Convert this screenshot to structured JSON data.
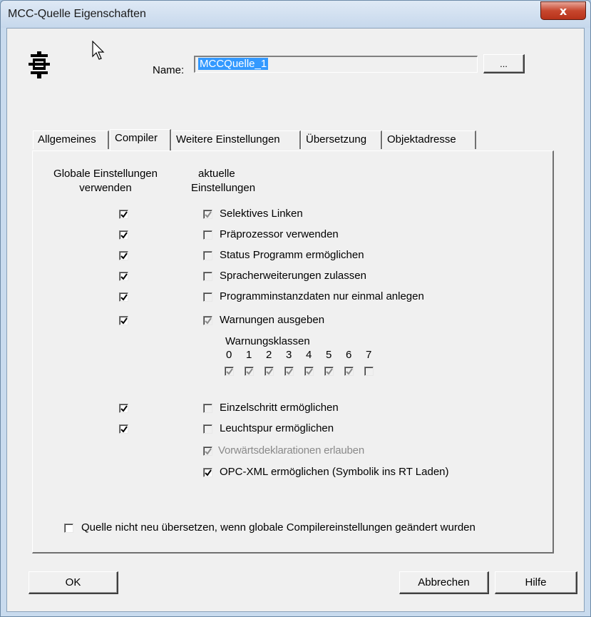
{
  "window": {
    "title": "MCC-Quelle Eigenschaften",
    "close_glyph": "x"
  },
  "header": {
    "icon": "mcc-source-icon",
    "name_label": "Name:",
    "name_value": "MCCQuelle_1",
    "browse_label": "..."
  },
  "tabs": [
    {
      "label": "Allgemeines",
      "active": false
    },
    {
      "label": "Compiler",
      "active": true
    },
    {
      "label": "Weitere Einstellungen",
      "active": false
    },
    {
      "label": "Übersetzung",
      "active": false
    },
    {
      "label": "Objektadresse",
      "active": false
    }
  ],
  "compiler": {
    "col_global_line1": "Globale Einstellungen",
    "col_global_line2": "verwenden",
    "col_current_line1": "aktuelle",
    "col_current_line2": "Einstellungen",
    "options": [
      {
        "label": "Selektives Linken",
        "global": true,
        "current": true,
        "current_enabled": false
      },
      {
        "label": "Präprozessor verwenden",
        "global": true,
        "current": false,
        "current_enabled": false
      },
      {
        "label": "Status Programm ermöglichen",
        "global": true,
        "current": false,
        "current_enabled": false
      },
      {
        "label": "Spracherweiterungen zulassen",
        "global": true,
        "current": false,
        "current_enabled": false
      },
      {
        "label": "Programminstanzdaten nur einmal anlegen",
        "global": true,
        "current": false,
        "current_enabled": false
      },
      {
        "label": "Warnungen ausgeben",
        "global": true,
        "current": true,
        "current_enabled": false
      }
    ],
    "warning_classes_label": "Warnungsklassen",
    "warning_classes": [
      {
        "num": "0",
        "checked": true
      },
      {
        "num": "1",
        "checked": true
      },
      {
        "num": "2",
        "checked": true
      },
      {
        "num": "3",
        "checked": true
      },
      {
        "num": "4",
        "checked": true
      },
      {
        "num": "5",
        "checked": true
      },
      {
        "num": "6",
        "checked": true
      },
      {
        "num": "7",
        "checked": false
      }
    ],
    "options2": [
      {
        "label": "Einzelschritt ermöglichen",
        "global": true,
        "current": false
      },
      {
        "label": "Leuchtspur ermöglichen",
        "global": true,
        "current": false
      }
    ],
    "forward_decl": {
      "label": "Vorwärtsdeklarationen erlauben",
      "checked": true,
      "enabled": false
    },
    "opc_xml": {
      "label": "OPC-XML ermöglichen (Symbolik ins RT Laden)",
      "checked": true,
      "enabled": true
    },
    "no_recompile": {
      "label": "Quelle nicht neu übersetzen, wenn globale Compilereinstellungen geändert wurden",
      "checked": false
    }
  },
  "buttons": {
    "ok": "OK",
    "cancel": "Abbrechen",
    "help": "Hilfe"
  },
  "colors": {
    "selection": "#3399ff",
    "dialog_bg": "#f0f0f0",
    "close_button": "#c7472e"
  }
}
